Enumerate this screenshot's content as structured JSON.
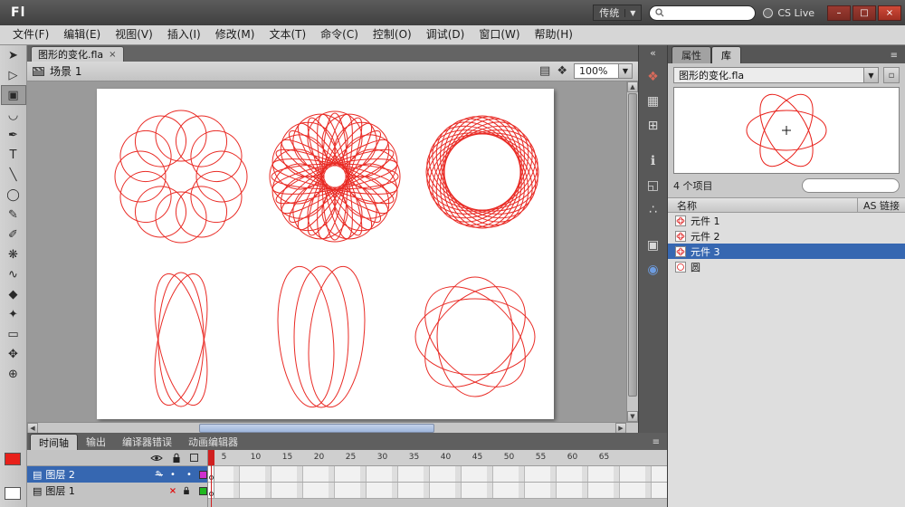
{
  "titlebar": {
    "logo": "Fl",
    "workspace": "传统",
    "cs_live": "CS Live",
    "minimize": "–",
    "restore": "□",
    "close": "×"
  },
  "menubar": {
    "items": [
      "文件(F)",
      "编辑(E)",
      "视图(V)",
      "插入(I)",
      "修改(M)",
      "文本(T)",
      "命令(C)",
      "控制(O)",
      "调试(D)",
      "窗口(W)",
      "帮助(H)"
    ]
  },
  "doc_tab": {
    "title": "图形的变化.fla",
    "close": "×"
  },
  "edit_bar": {
    "scene_label": "场景 1",
    "zoom_value": "100%",
    "drop_arrow": "▼"
  },
  "toolbar": {
    "tools": [
      {
        "name": "selection-tool",
        "glyph": "➤"
      },
      {
        "name": "subselection-tool",
        "glyph": "▷"
      },
      {
        "name": "free-transform-tool",
        "glyph": "▣"
      },
      {
        "name": "lasso-tool",
        "glyph": "◡"
      },
      {
        "name": "pen-tool",
        "glyph": "✒"
      },
      {
        "name": "text-tool",
        "glyph": "T"
      },
      {
        "name": "line-tool",
        "glyph": "╲"
      },
      {
        "name": "oval-tool",
        "glyph": "◯"
      },
      {
        "name": "pencil-tool",
        "glyph": "✎"
      },
      {
        "name": "brush-tool",
        "glyph": "✐"
      },
      {
        "name": "deco-tool",
        "glyph": "❋"
      },
      {
        "name": "bone-tool",
        "glyph": "∿"
      },
      {
        "name": "paint-bucket-tool",
        "glyph": "◆"
      },
      {
        "name": "eyedropper-tool",
        "glyph": "✦"
      },
      {
        "name": "eraser-tool",
        "glyph": "▭"
      },
      {
        "name": "hand-tool",
        "glyph": "✥"
      },
      {
        "name": "zoom-tool",
        "glyph": "⊕"
      }
    ]
  },
  "dock": {
    "collapse": "«",
    "icons": [
      {
        "name": "color-panel-icon",
        "glyph": "❖"
      },
      {
        "name": "swatches-panel-icon",
        "glyph": "▦"
      },
      {
        "name": "align-panel-icon",
        "glyph": "⊞"
      },
      {
        "name": "info-panel-icon",
        "glyph": "ℹ"
      },
      {
        "name": "transform-panel-icon",
        "glyph": "◱"
      },
      {
        "name": "code-snippets-panel-icon",
        "glyph": "∴"
      },
      {
        "name": "components-panel-icon",
        "glyph": "▣"
      },
      {
        "name": "web-panel-icon",
        "glyph": "◉"
      }
    ]
  },
  "right_panel": {
    "tabs": {
      "properties": "属性",
      "library": "库"
    },
    "menu_icon": "≡",
    "library": {
      "doc_name": "图形的变化.fla",
      "drop_arrow": "▼",
      "item_count": "4 个项目",
      "name_col": "名称",
      "linkage_col": "AS 链接",
      "items": [
        {
          "label": "元件 1"
        },
        {
          "label": "元件 2"
        },
        {
          "label": "元件 3"
        },
        {
          "label": "圆"
        }
      ]
    }
  },
  "bottom_panel": {
    "tabs": [
      "时间轴",
      "输出",
      "编译器错误",
      "动画编辑器"
    ],
    "menu_icon": "≡"
  },
  "timeline": {
    "frames": [
      "5",
      "10",
      "15",
      "20",
      "25",
      "30",
      "35",
      "40",
      "45",
      "50",
      "55",
      "60",
      "65"
    ],
    "layers": [
      {
        "name": "图层 2",
        "eye_mark": "•",
        "lock_mark": "•",
        "outline_color": "#cf30cf",
        "pencil_mark": "✎"
      },
      {
        "name": "图层 1",
        "eye_mark": "×",
        "lock_mark": "•",
        "outline_color": "#1fb81f",
        "pencil_mark": ""
      }
    ]
  },
  "colors": {
    "artwork_red": "#e8201a",
    "selection_blue": "#3667b1",
    "stroke_swatch": "#e8201a",
    "fill_swatch": "#ffffff"
  }
}
